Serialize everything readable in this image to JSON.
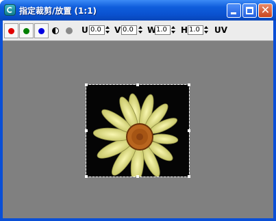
{
  "window": {
    "title": "指定裁剪/放置 (1:1)"
  },
  "titlebar_buttons": {
    "minimize": "minimize",
    "maximize": "maximize",
    "close": "✕"
  },
  "toolbar": {
    "channels": [
      {
        "name": "red-channel",
        "color": "#e00000"
      },
      {
        "name": "green-channel",
        "color": "#008000"
      },
      {
        "name": "blue-channel",
        "color": "#0000e0"
      }
    ],
    "params": [
      {
        "label": "U",
        "value": "0.0"
      },
      {
        "label": "V",
        "value": "0.0"
      },
      {
        "label": "W",
        "value": "1.0"
      },
      {
        "label": "H",
        "value": "1.0"
      }
    ],
    "uv_label": "UV"
  },
  "colors": {
    "viewport_bg": "#808080",
    "title_bar": "#0a52d0"
  }
}
